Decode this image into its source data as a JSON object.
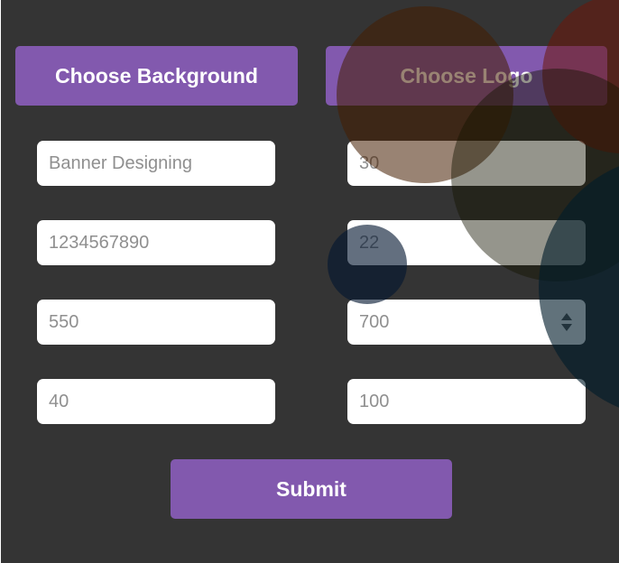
{
  "buttons": {
    "choose_background": "Choose Background",
    "choose_logo": "Choose Logo",
    "submit": "Submit"
  },
  "fields": {
    "banner_title": "Banner Designing",
    "phone": "1234567890",
    "banner_width": "550",
    "logo_size": "40",
    "title_font_size": "30",
    "phone_font_size": "22",
    "banner_height": "700",
    "logo_offset": "100"
  },
  "colors": {
    "background": "#343434",
    "accent": "#8259ae",
    "field_text": "#8f8f8f"
  },
  "icons": {
    "spinner": "number-stepper-arrows"
  }
}
